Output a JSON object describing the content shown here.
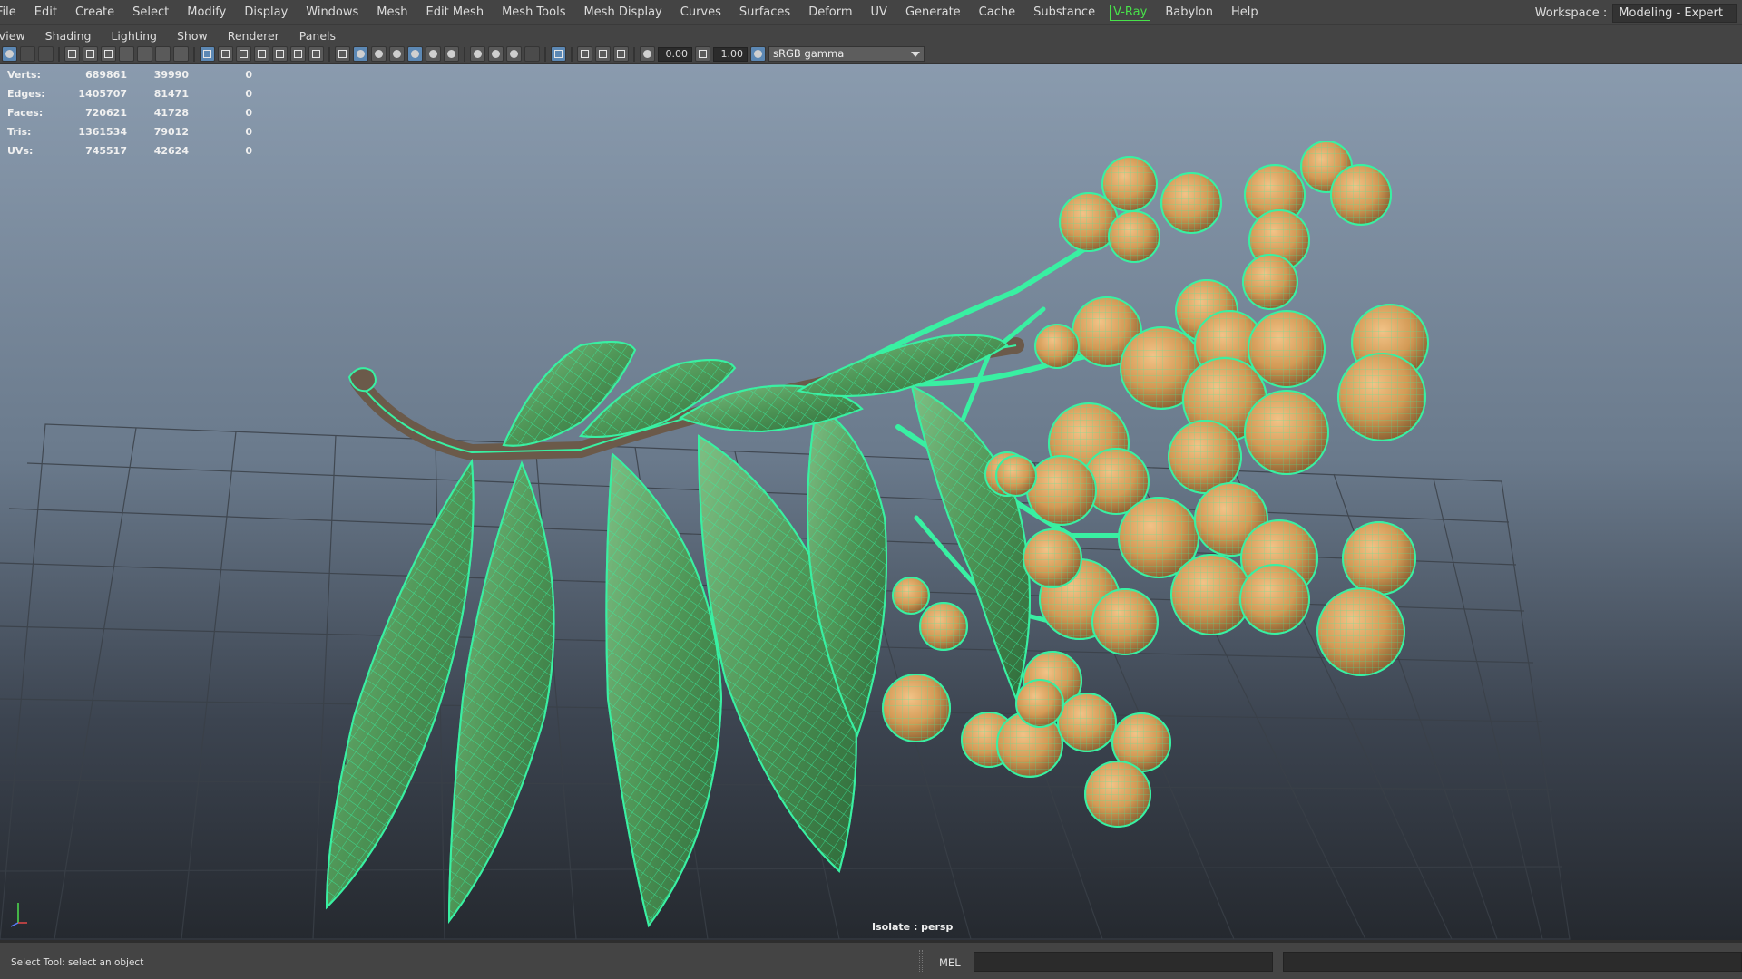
{
  "menubar": {
    "items": [
      "File",
      "Edit",
      "Create",
      "Select",
      "Modify",
      "Display",
      "Windows",
      "Mesh",
      "Edit Mesh",
      "Mesh Tools",
      "Mesh Display",
      "Curves",
      "Surfaces",
      "Deform",
      "UV",
      "Generate",
      "Cache",
      "Substance",
      "V-Ray",
      "Babylon",
      "Help"
    ],
    "workspace_label": "Workspace :",
    "workspace_value": "Modeling - Expert"
  },
  "panel_menu": {
    "items": [
      "View",
      "Shading",
      "Lighting",
      "Show",
      "Renderer",
      "Panels"
    ]
  },
  "toolbar": {
    "exposure_value": "0.00",
    "gamma_value": "1.00",
    "color_space": "sRGB gamma"
  },
  "hud": {
    "rows": [
      {
        "label": "Verts:",
        "total": "689861",
        "selected": "39990",
        "components": "0"
      },
      {
        "label": "Edges:",
        "total": "1405707",
        "selected": "81471",
        "components": "0"
      },
      {
        "label": "Faces:",
        "total": "720621",
        "selected": "41728",
        "components": "0"
      },
      {
        "label": "Tris:",
        "total": "1361534",
        "selected": "79012",
        "components": "0"
      },
      {
        "label": "UVs:",
        "total": "745517",
        "selected": "42624",
        "components": "0"
      }
    ]
  },
  "viewport": {
    "camera_label": "Isolate : persp"
  },
  "statusbar": {
    "help_text": "Select Tool: select an object",
    "mel_label": "MEL"
  },
  "colors": {
    "wireframe": "#39f0a2",
    "leaf": "#4f9a55",
    "berry": "#d9a35e",
    "branch": "#6b5a4a"
  }
}
